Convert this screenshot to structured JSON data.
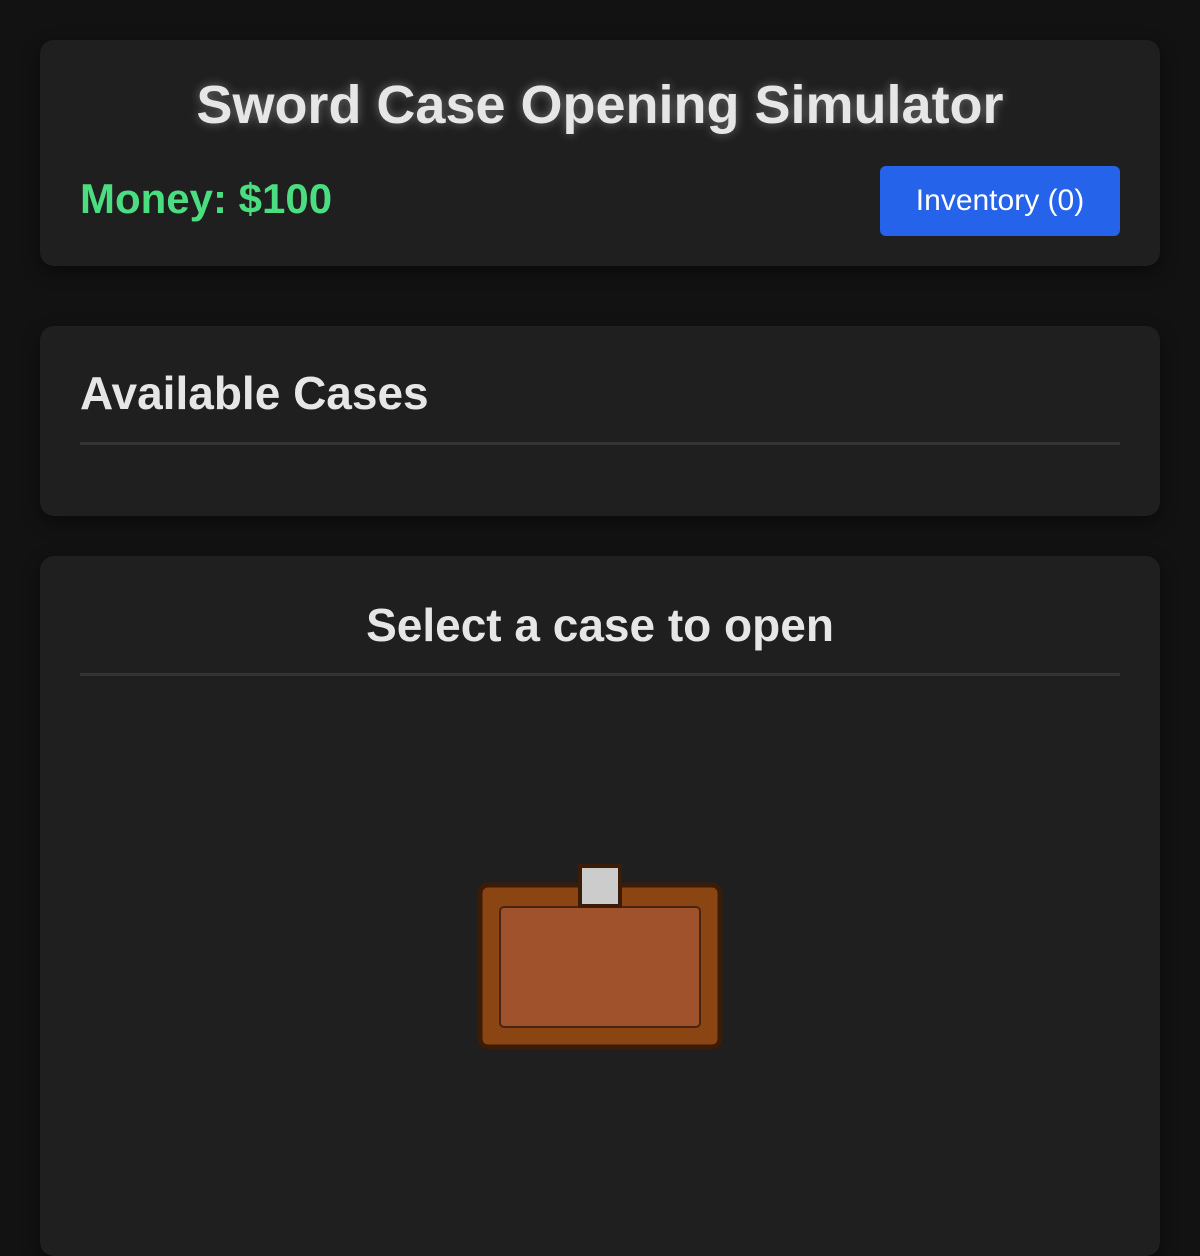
{
  "header": {
    "title": "Sword Case Opening Simulator",
    "money_label": "Money: $100",
    "inventory_button": "Inventory (0)"
  },
  "cases_section": {
    "title": "Available Cases"
  },
  "opener": {
    "title": "Select a case to open",
    "case_icon": "briefcase-icon"
  },
  "colors": {
    "background": "#121212",
    "card": "#1f1f1f",
    "money": "#4ade80",
    "accent": "#2563eb",
    "case_body": "#8b4513",
    "case_panel": "#a0522d",
    "case_latch": "#cccccc"
  }
}
